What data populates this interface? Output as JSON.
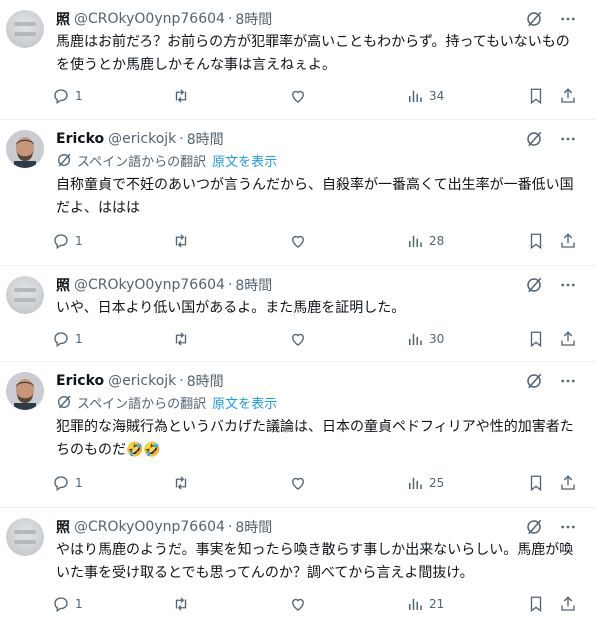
{
  "posts": [
    {
      "author_name": "照",
      "author_handle": "@CROkyO0ynp76604",
      "time_ago": "8時間",
      "body": "馬鹿はお前だろ？お前らの方が犯罪率が高いこともわからず。持ってもいないものを使うとか馬鹿しかそんな事は言えねぇよ。",
      "replies": "1",
      "views": "34"
    },
    {
      "author_name": "Ericko",
      "author_handle": "@erickojk",
      "time_ago": "8時間",
      "translation_note": "スペイン語からの翻訳",
      "show_original": "原文を表示",
      "body": "自称童貞で不妊のあいつが言うんだから、自殺率が一番高くて出生率が一番低い国だよ、ははは",
      "replies": "1",
      "views": "28"
    },
    {
      "author_name": "照",
      "author_handle": "@CROkyO0ynp76604",
      "time_ago": "8時間",
      "body": "いや、日本より低い国があるよ。また馬鹿を証明した。",
      "replies": "1",
      "views": "30"
    },
    {
      "author_name": "Ericko",
      "author_handle": "@erickojk",
      "time_ago": "8時間",
      "translation_note": "スペイン語からの翻訳",
      "show_original": "原文を表示",
      "body": "犯罪的な海賊行為というバカげた議論は、日本の童貞ペドフィリアや性的加害者たちのものだ🤣🤣",
      "replies": "1",
      "views": "25"
    },
    {
      "author_name": "照",
      "author_handle": "@CROkyO0ynp76604",
      "time_ago": "8時間",
      "body": "やはり馬鹿のようだ。事実を知ったら喚き散らす事しか出来ないらしい。馬鹿が喚いた事を受け取るとでも思ってんのか？調べてから言えよ間抜け。",
      "replies": "1",
      "views": "21"
    }
  ],
  "separator": "·",
  "icons": {
    "grok": "grok-slash-icon",
    "more": "more-dots-icon",
    "translate": "translate-icon",
    "reply": "reply-icon",
    "repost": "repost-icon",
    "like": "heart-icon",
    "views": "views-bar-icon",
    "bookmark": "bookmark-icon",
    "share": "share-icon"
  },
  "colors": {
    "text": "#0f1419",
    "secondary": "#536471",
    "link": "#1d9bf0",
    "divider": "#eff3f4"
  }
}
